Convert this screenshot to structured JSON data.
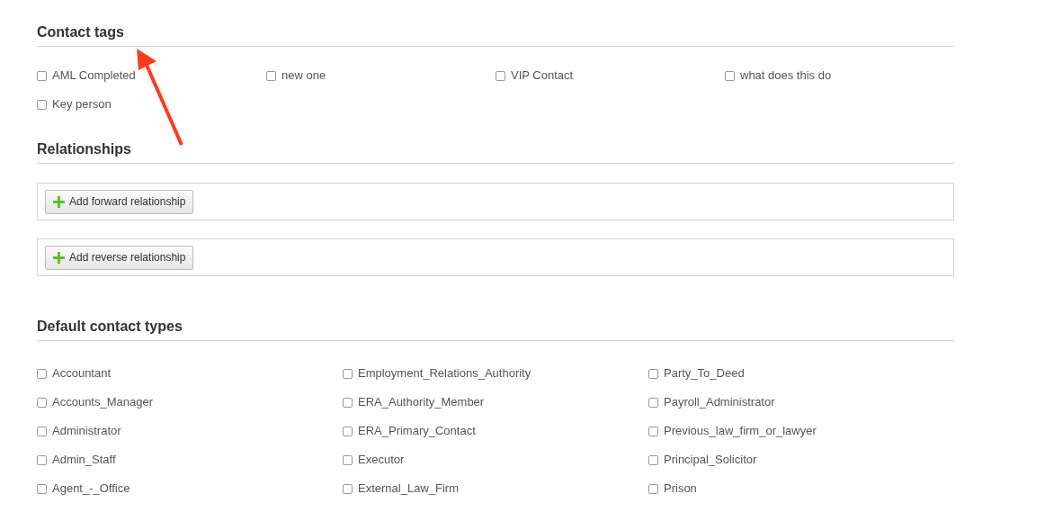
{
  "contact_tags": {
    "title": "Contact tags",
    "items": [
      {
        "label": "AML Completed",
        "checked": false
      },
      {
        "label": "new one",
        "checked": false
      },
      {
        "label": "VIP Contact",
        "checked": false
      },
      {
        "label": "what does this do",
        "checked": false
      },
      {
        "label": "Key person",
        "checked": false
      }
    ]
  },
  "relationships": {
    "title": "Relationships",
    "buttons": [
      {
        "label": "Add forward relationship"
      },
      {
        "label": "Add reverse relationship"
      }
    ]
  },
  "default_contact_types": {
    "title": "Default contact types",
    "items": [
      {
        "label": "Accountant",
        "checked": false
      },
      {
        "label": "Employment_Relations_Authority",
        "checked": false
      },
      {
        "label": "Party_To_Deed",
        "checked": false
      },
      {
        "label": "Accounts_Manager",
        "checked": false
      },
      {
        "label": "ERA_Authority_Member",
        "checked": false
      },
      {
        "label": "Payroll_Administrator",
        "checked": false
      },
      {
        "label": "Administrator",
        "checked": false
      },
      {
        "label": "ERA_Primary_Contact",
        "checked": false
      },
      {
        "label": "Previous_law_firm_or_lawyer",
        "checked": false
      },
      {
        "label": "Admin_Staff",
        "checked": false
      },
      {
        "label": "Executor",
        "checked": false
      },
      {
        "label": "Principal_Solicitor",
        "checked": false
      },
      {
        "label": "Agent_-_Office",
        "checked": false
      },
      {
        "label": "External_Law_Firm",
        "checked": false
      },
      {
        "label": "Prison",
        "checked": false
      }
    ]
  }
}
